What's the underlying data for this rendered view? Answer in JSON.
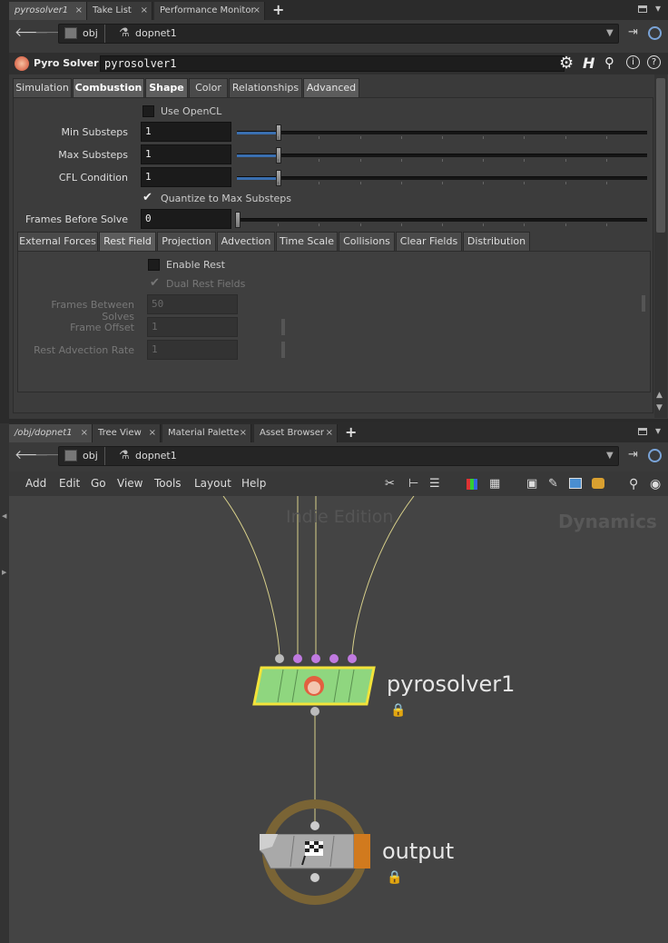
{
  "top_tabs": [
    {
      "label": "pyrosolver1",
      "close": "×"
    },
    {
      "label": "Take List",
      "close": "×"
    },
    {
      "label": "Performance Monitor",
      "close": "×"
    }
  ],
  "plus": "+",
  "path_top": {
    "root": "obj",
    "node": "dopnet1"
  },
  "node_header": {
    "type": "Pyro Solver",
    "name": "pyrosolver1"
  },
  "main_tabs": [
    "Simulation",
    "Combustion",
    "Shape",
    "Color",
    "Relationships",
    "Advanced"
  ],
  "params": {
    "use_opencl": "Use OpenCL",
    "min_substeps": {
      "label": "Min Substeps",
      "value": "1"
    },
    "max_substeps": {
      "label": "Max Substeps",
      "value": "1"
    },
    "cfl": {
      "label": "CFL Condition",
      "value": "1"
    },
    "quantize": "Quantize to Max Substeps",
    "frames_before": {
      "label": "Frames Before Solve",
      "value": "0"
    }
  },
  "sub_tabs": [
    "External Forces",
    "Rest Field",
    "Projection",
    "Advection",
    "Time Scale",
    "Collisions",
    "Clear Fields",
    "Distribution"
  ],
  "rest": {
    "enable": "Enable Rest",
    "dual": "Dual Rest Fields",
    "frames_between": {
      "label": "Frames Between Solves",
      "value": "50"
    },
    "frame_offset": {
      "label": "Frame Offset",
      "value": "1"
    },
    "advection_rate": {
      "label": "Rest Advection Rate",
      "value": "1"
    }
  },
  "net_tabs": [
    {
      "label": "/obj/dopnet1",
      "close": "×"
    },
    {
      "label": "Tree View",
      "close": "×"
    },
    {
      "label": "Material Palette",
      "close": "×"
    },
    {
      "label": "Asset Browser",
      "close": "×"
    }
  ],
  "path_bottom": {
    "root": "obj",
    "node": "dopnet1"
  },
  "menu": [
    "Add",
    "Edit",
    "Go",
    "View",
    "Tools",
    "Layout",
    "Help"
  ],
  "network": {
    "watermark": "Indie Edition",
    "context": "Dynamics",
    "node1": "pyrosolver1",
    "node2": "output"
  },
  "colors": {
    "accent": "#3a6fb0",
    "node_green": "#8fd67f",
    "wire": "#d8d08a",
    "input_purple": "#c07ae0"
  }
}
